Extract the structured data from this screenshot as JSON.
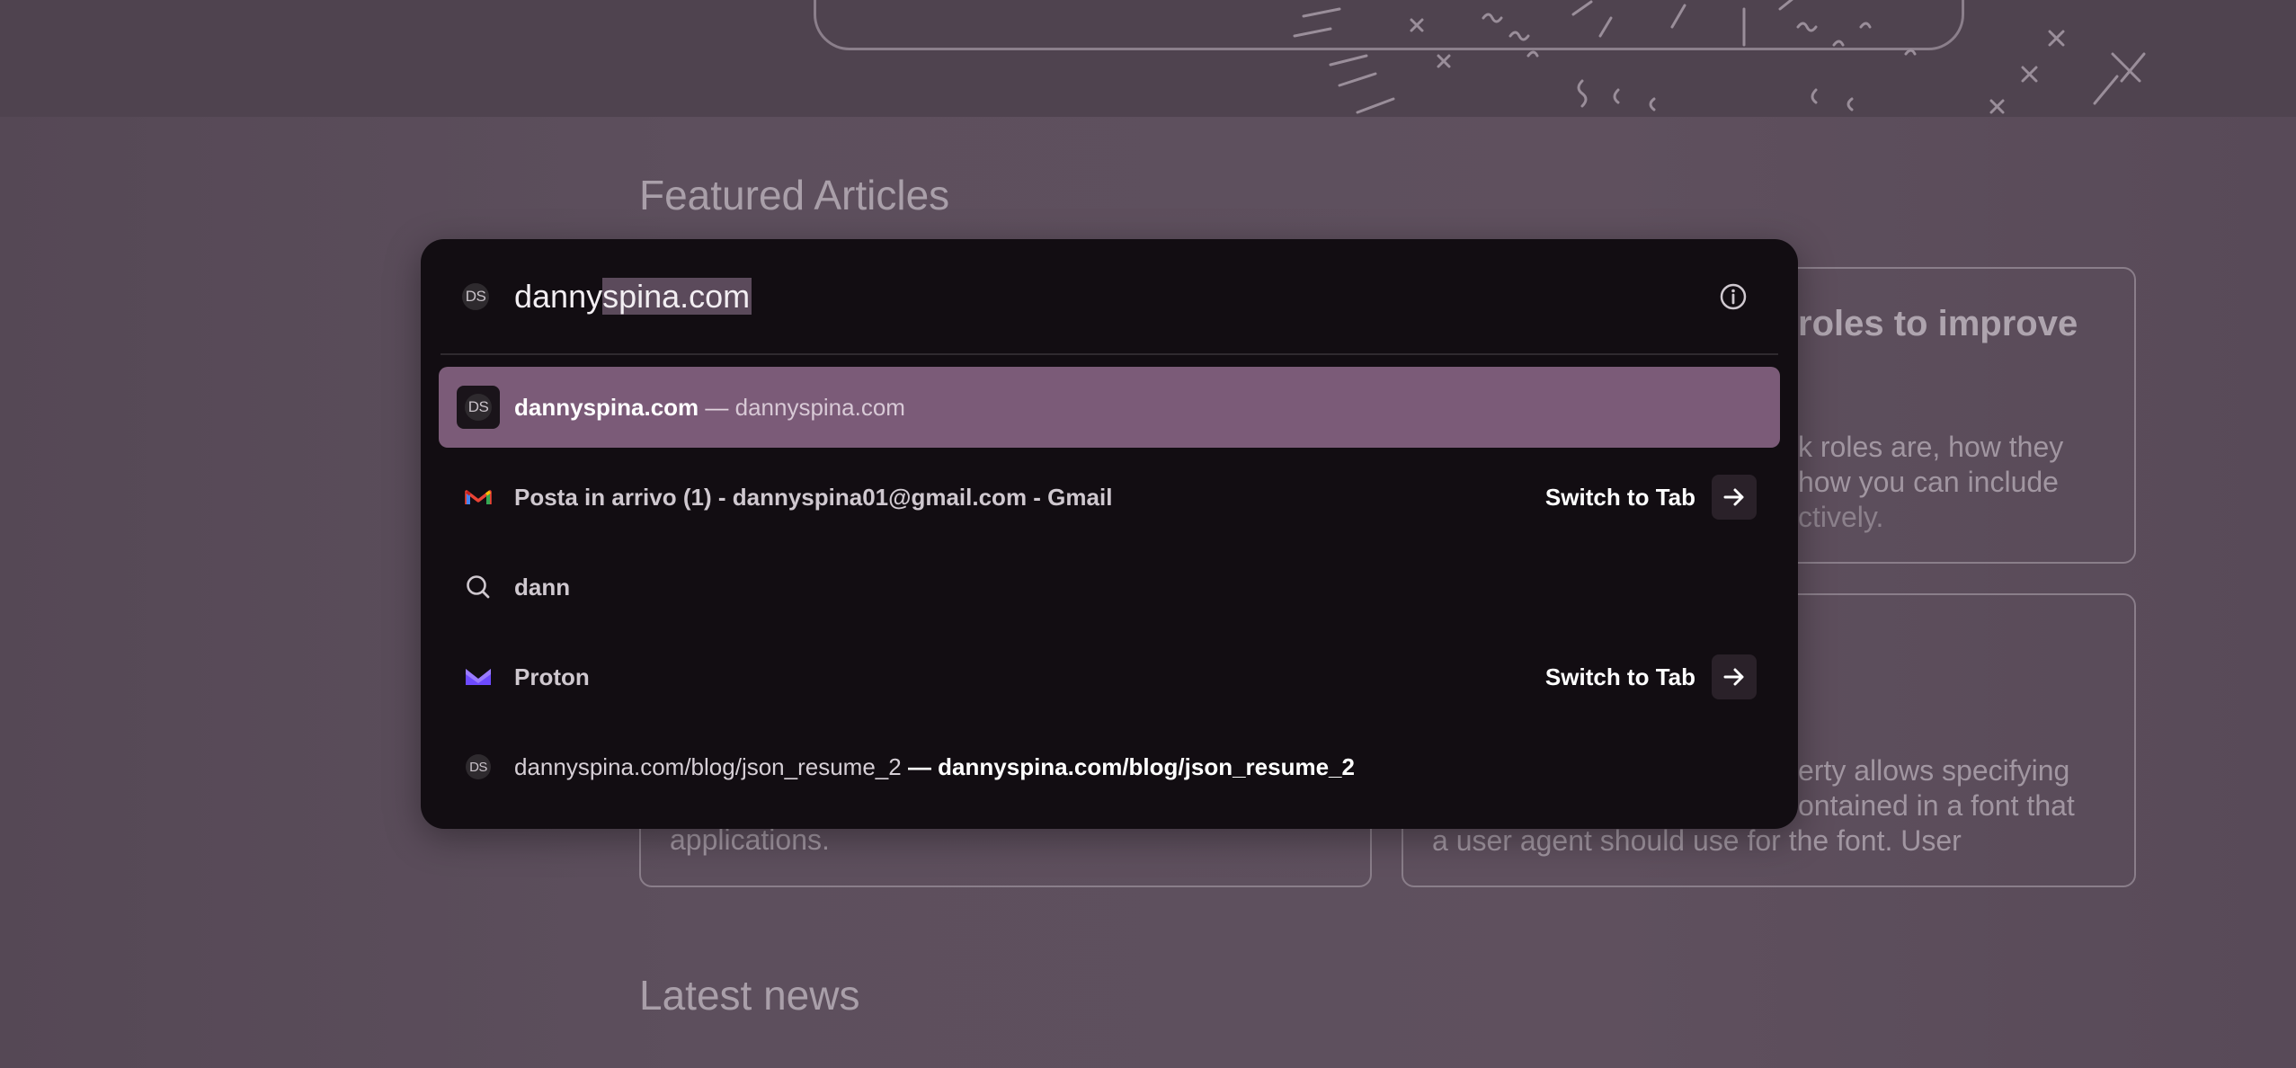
{
  "background": {
    "featured_title": "Featured Articles",
    "latest_title": "Latest news",
    "card1": {
      "heading_fragment": "roles to improve",
      "line1": "k roles are, how they",
      "line2": "how you can include",
      "line3": "ctively."
    },
    "card2": {
      "line1": "erty allows specifying",
      "line2": "ontained in a font that",
      "line3": "a user agent should use for the font. User"
    },
    "card3": {
      "line1": "applications."
    }
  },
  "urlbar": {
    "site_badge": "DS",
    "input_prefix": "danny",
    "input_selected": "spina.com",
    "info_icon": "info-icon",
    "results": [
      {
        "icon": "DS",
        "title": "dannyspina.com",
        "separator": " — ",
        "url": "dannyspina.com",
        "selected": true
      },
      {
        "icon": "gmail-icon",
        "title": "Posta in arrivo (1) - dannyspina01@gmail.com - Gmail",
        "action": "Switch to Tab"
      },
      {
        "icon": "search-icon",
        "title": "dann"
      },
      {
        "icon": "proton-icon",
        "title": "Proton",
        "action": "Switch to Tab"
      },
      {
        "icon": "DS",
        "title": "dannyspina.com/blog/json_resume_2",
        "separator": " — ",
        "url": "dannyspina.com/blog/json_resume_2"
      }
    ]
  },
  "colors": {
    "selected_row": "#7b5b78",
    "popup_bg": "#120d12",
    "page_bg": "#5a4c5a"
  }
}
